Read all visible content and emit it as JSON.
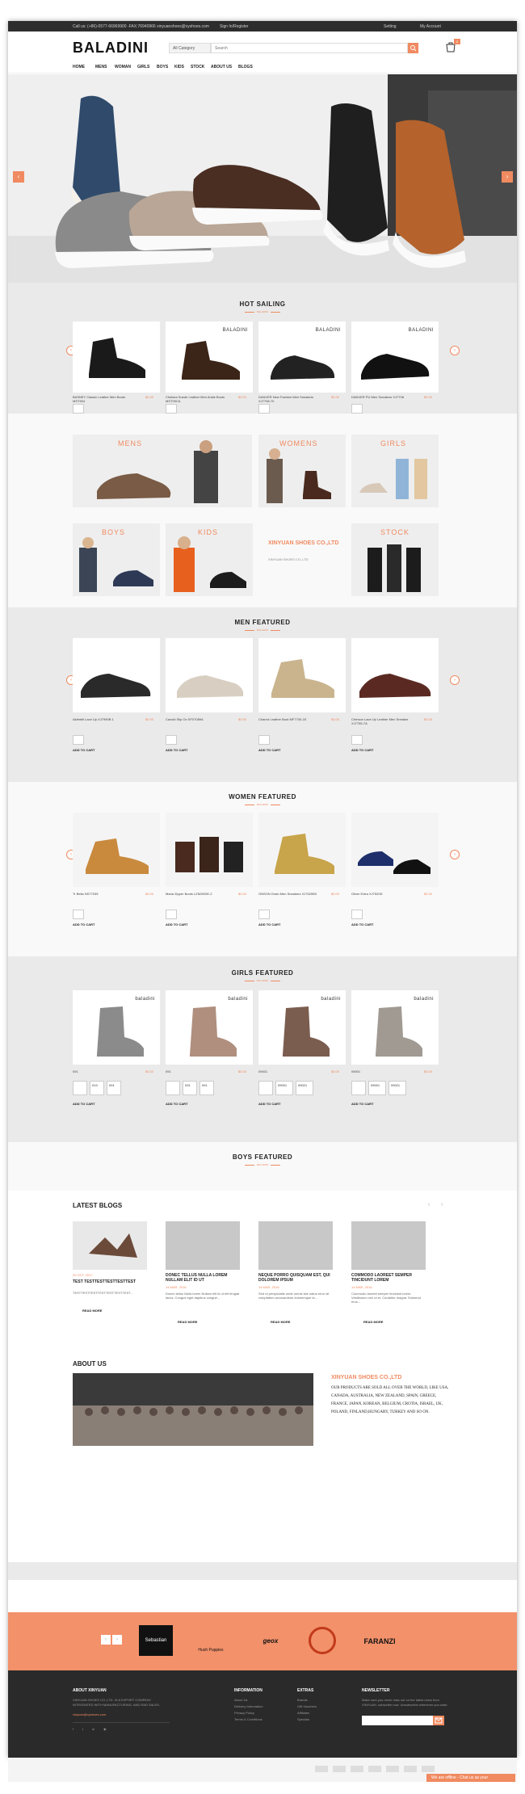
{
  "topbar": {
    "contact": "Call us: (+86)-0577-66969900 -FAX:76940966   xinyuanshoes@xyshoes.com",
    "login": "Sign In/Register",
    "setting": "Setting",
    "account": "My Account"
  },
  "header": {
    "logo": "BALADINI",
    "category": "All Category",
    "search_placeholder": "Search",
    "cart_count": "0"
  },
  "nav": [
    "HOME",
    "MENS",
    "WOMAN",
    "GIRLS",
    "BOYS",
    "KIDS",
    "STOCK",
    "ABOUT US",
    "BLOGS"
  ],
  "hot": {
    "title": "HOT SAILING",
    "sub": "BALADINI",
    "products": [
      {
        "name": "BASNEY Classic Leather Men Boots MST904",
        "price": "$0.00",
        "brand": ""
      },
      {
        "name": "Chelsea Suede Leather Men Ankle Boots MST09CA",
        "price": "$0.00",
        "brand": "BALADINI"
      },
      {
        "name": "DANVER New Fashion Men Sneakers XJ7708-70",
        "price": "$0.00",
        "brand": "BALADINI"
      },
      {
        "name": "DANVER PU Men Sneakers XJ7708",
        "price": "$0.00",
        "brand": "BALADINI"
      }
    ],
    "add_to_cart": "ADD TO CART"
  },
  "banners": {
    "mens": "MENS",
    "womens": "WOMENS",
    "girls": "GIRLS",
    "boys": "BOYS",
    "kids": "KIDS",
    "company": "XINYUAN SHOES CO.,LTD",
    "company_sub": "XINYUAN SHOES CO.,LTD",
    "stock": "STOCK"
  },
  "men": {
    "title": "MEN FEATURED",
    "sub": "BALADINI",
    "products": [
      {
        "name": "Aktimbil Lace Up XJ7990B 1",
        "price": "$0.00"
      },
      {
        "name": "Cavold Slip On SF07089A",
        "price": "$0.00"
      },
      {
        "name": "Charrot Leather Boot MF7700-1E",
        "price": "$0.00"
      },
      {
        "name": "Crimson Lace Up Leather Men Sneaker XJ7755-7A",
        "price": "$0.00"
      }
    ]
  },
  "women": {
    "title": "WOMEN FEATURED",
    "sub": "BALADINI",
    "products": [
      {
        "name": "Tr Bella NS77035",
        "price": "$0.00"
      },
      {
        "name": "Maria Zipper Boots LZN0920E-2",
        "price": "$0.00"
      },
      {
        "name": "ONSON Grain Men Sneakers XJ7520B3",
        "price": "$0.00"
      },
      {
        "name": "Oliver Extra XJ7520D",
        "price": "$0.00"
      }
    ]
  },
  "girls": {
    "title": "GIRLS FEATURED",
    "sub": "BALADINI",
    "brand": "baladini",
    "products": [
      {
        "name": "091",
        "price": "$0.00",
        "sizes": [
          "",
          "019",
          "091"
        ]
      },
      {
        "name": "091",
        "price": "$0.00",
        "sizes": [
          "",
          "031",
          "091"
        ]
      },
      {
        "name": "09001",
        "price": "$0.00",
        "sizes": [
          "",
          "09001",
          "09021"
        ]
      },
      {
        "name": "09001",
        "price": "$0.00",
        "sizes": [
          "",
          "09001",
          "09021"
        ]
      }
    ]
  },
  "boys": {
    "title": "BOYS FEATURED",
    "sub": "BALADINI"
  },
  "blogs": {
    "title": "LATEST BLOGS",
    "items": [
      {
        "title": "TEST TESTTESTTESTTESTTEST",
        "date": "20 OCT, 2017",
        "text": "TESTTESTTESTTESTTESTTESTTEST...",
        "more": "READ MORE"
      },
      {
        "title": "DONEC TELLUS NULLA LOREM NULLAM ELIT ID UT",
        "date": "14 MAR, 2016",
        "text": "Donec tellus Nulla lorem Nullam elit id ut elit feugiat lacus. Congue eget dapibus congue...",
        "more": "READ MORE"
      },
      {
        "title": "NEQUE PORRO QUISQUAM EST, QUI DOLOREM IPSUM",
        "date": "14 MAR, 2016",
        "text": "Sed ut perspiciatis unde omnis iste natus error sit voluptatem accusantium doloremque la...",
        "more": "READ MORE"
      },
      {
        "title": "COMMODO LAOREET SEMPER TINCIDUNT LOREM",
        "date": "14 MAR, 2016",
        "text": "Commodo laoreet semper tincidunt lorem. Vestibulum orci ut et. Curabitur magna. Euismod eros...",
        "more": "READ MORE"
      }
    ]
  },
  "about": {
    "title": "ABOUT US",
    "company": "XINYUAN SHOES CO.,LTD",
    "text": "OUR PRODUCTS ARE SOLD ALL OVER THE WORLD, LIKE USA, CANADA, AUSTRALIA, NEW ZEALAND, SPAIN, GREECE, FRANCE, JAPAN, KOREAN, BELGIUM, CROTIA, ISRAEL, UK, POLAND, FINLAND,HUNGARY, TURKEY AND SO ON."
  },
  "brands": [
    "Sebastian",
    "Hush Puppies",
    "geox",
    "",
    "FARANZI",
    ""
  ],
  "footer": {
    "about_title": "ABOUT XINYUAN",
    "about_text": "XINYUAN SHOES CO.,LTD. IS A EXPORT COMPANY INTEGRATED WITH MANUFACTURING, AND RAD SALES.",
    "email": "xinyuan@xyshoes.com",
    "info_title": "INFORMATION",
    "info_links": [
      "About Us",
      "Delivery Information",
      "Privacy Policy",
      "Terms & Conditions"
    ],
    "extras_title": "EXTRAS",
    "extras_links": [
      "Brands",
      "Gift Vouchers",
      "Affiliates",
      "Specials"
    ],
    "news_title": "NEWSLETTER",
    "news_text": "Make sure you never miss out on the latest news from XINYUAN, subscribe now. Unsubscribe whenever you want.",
    "chat": "We are offline - Chat us as your"
  },
  "colors": {
    "accent": "#f08a60",
    "dark": "#2d2d2d"
  }
}
